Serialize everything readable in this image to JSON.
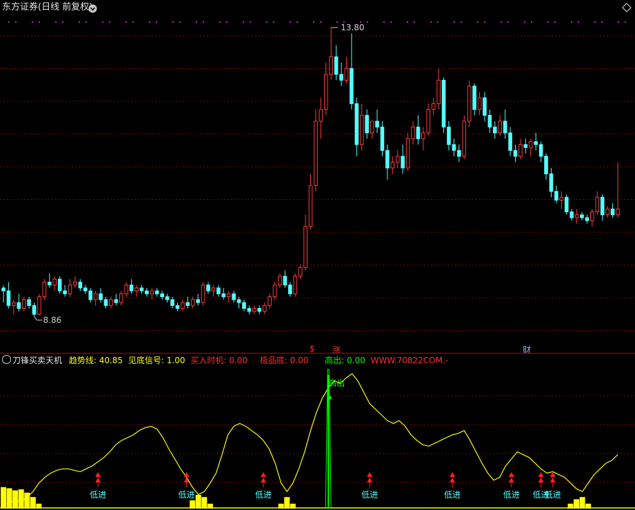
{
  "window": {
    "title": "东方证券(日线 前复权)",
    "collapse_icon": "circle-chevron-down-icon",
    "corner_icon": "diamond-icon"
  },
  "main_chart": {
    "high_label": "13.80",
    "low_label": "8.86",
    "event_tags": [
      {
        "text": "$",
        "color": "#ff3030"
      },
      {
        "text": "涨",
        "color": "#ff3030"
      },
      {
        "text": "财",
        "color": "#8fb0ff"
      }
    ]
  },
  "indicator": {
    "name": "刀锋买卖天机",
    "values": [
      {
        "label": "趋势线:",
        "value": "40.85",
        "color": "#ffff00"
      },
      {
        "label": "见底信号:",
        "value": "1.00",
        "color": "#ffff00"
      },
      {
        "label": "买入时机:",
        "value": "0.00",
        "color": "#ff3030"
      },
      {
        "label": "极品底:",
        "value": "0.00",
        "color": "#ff3030"
      },
      {
        "label": "高出:",
        "value": "0.00",
        "color": "#00ff00"
      }
    ],
    "website": "WWW.70822COM.-",
    "sell_label": "高出",
    "buy_label": "低进"
  },
  "colors": {
    "up": "#ff3c3c",
    "down": "#54ffff",
    "grid": "#8b0000",
    "trend": "#ffff00",
    "signal": "#00ff00"
  },
  "chart_data": [
    {
      "type": "candlestick",
      "title": "东方证券(日线 前复权)",
      "ylim": [
        8.5,
        14.0
      ],
      "annotations": {
        "max": 13.8,
        "min": 8.86
      },
      "candles": [
        [
          9.35,
          9.4,
          9.1,
          9.3
        ],
        [
          9.3,
          9.45,
          9.0,
          9.05
        ],
        [
          9.05,
          9.15,
          8.9,
          9.1
        ],
        [
          9.1,
          9.25,
          8.95,
          9.0
        ],
        [
          9.0,
          9.2,
          8.95,
          9.15
        ],
        [
          9.15,
          9.2,
          9.0,
          9.05
        ],
        [
          9.05,
          9.1,
          8.86,
          8.9
        ],
        [
          8.9,
          9.25,
          8.88,
          9.2
        ],
        [
          9.2,
          9.5,
          9.15,
          9.45
        ],
        [
          9.45,
          9.6,
          9.35,
          9.4
        ],
        [
          9.4,
          9.55,
          9.3,
          9.5
        ],
        [
          9.5,
          9.55,
          9.25,
          9.3
        ],
        [
          9.3,
          9.4,
          9.2,
          9.25
        ],
        [
          9.25,
          9.5,
          9.2,
          9.4
        ],
        [
          9.4,
          9.55,
          9.35,
          9.45
        ],
        [
          9.45,
          9.5,
          9.3,
          9.35
        ],
        [
          9.35,
          9.4,
          9.25,
          9.3
        ],
        [
          9.3,
          9.35,
          9.1,
          9.15
        ],
        [
          9.15,
          9.3,
          9.05,
          9.25
        ],
        [
          9.25,
          9.35,
          9.1,
          9.15
        ],
        [
          9.15,
          9.2,
          9.0,
          9.05
        ],
        [
          9.05,
          9.2,
          9.0,
          9.15
        ],
        [
          9.15,
          9.25,
          9.05,
          9.1
        ],
        [
          9.1,
          9.3,
          9.05,
          9.25
        ],
        [
          9.25,
          9.45,
          9.2,
          9.4
        ],
        [
          9.4,
          9.5,
          9.25,
          9.3
        ],
        [
          9.3,
          9.4,
          9.2,
          9.35
        ],
        [
          9.35,
          9.4,
          9.25,
          9.3
        ],
        [
          9.3,
          9.35,
          9.2,
          9.25
        ],
        [
          9.25,
          9.35,
          9.15,
          9.3
        ],
        [
          9.3,
          9.35,
          9.2,
          9.25
        ],
        [
          9.25,
          9.3,
          9.15,
          9.2
        ],
        [
          9.2,
          9.25,
          9.1,
          9.15
        ],
        [
          9.15,
          9.2,
          9.0,
          9.05
        ],
        [
          9.05,
          9.1,
          8.95,
          9.0
        ],
        [
          9.0,
          9.15,
          8.95,
          9.1
        ],
        [
          9.1,
          9.2,
          9.0,
          9.05
        ],
        [
          9.05,
          9.2,
          9.0,
          9.15
        ],
        [
          9.15,
          9.25,
          9.05,
          9.1
        ],
        [
          9.1,
          9.45,
          9.05,
          9.4
        ],
        [
          9.4,
          9.45,
          9.25,
          9.3
        ],
        [
          9.3,
          9.4,
          9.2,
          9.35
        ],
        [
          9.35,
          9.4,
          9.2,
          9.25
        ],
        [
          9.25,
          9.35,
          9.15,
          9.2
        ],
        [
          9.2,
          9.3,
          9.1,
          9.25
        ],
        [
          9.25,
          9.3,
          9.1,
          9.15
        ],
        [
          9.15,
          9.2,
          9.0,
          9.1
        ],
        [
          9.1,
          9.15,
          8.95,
          9.0
        ],
        [
          9.0,
          9.05,
          8.9,
          8.95
        ],
        [
          8.95,
          9.05,
          8.9,
          9.0
        ],
        [
          9.0,
          9.05,
          8.9,
          8.95
        ],
        [
          8.95,
          9.1,
          8.9,
          9.05
        ],
        [
          9.05,
          9.25,
          9.0,
          9.2
        ],
        [
          9.2,
          9.45,
          9.15,
          9.4
        ],
        [
          9.4,
          9.6,
          9.35,
          9.55
        ],
        [
          9.55,
          9.65,
          9.35,
          9.4
        ],
        [
          9.4,
          9.45,
          9.2,
          9.25
        ],
        [
          9.25,
          9.6,
          9.2,
          9.55
        ],
        [
          9.55,
          9.75,
          9.5,
          9.7
        ],
        [
          9.7,
          10.6,
          9.65,
          10.4
        ],
        [
          10.4,
          11.3,
          10.35,
          11.1
        ],
        [
          11.1,
          12.4,
          11.0,
          12.2
        ],
        [
          12.2,
          12.6,
          11.9,
          12.4
        ],
        [
          12.4,
          13.2,
          12.3,
          13.0
        ],
        [
          13.0,
          13.8,
          12.9,
          13.3
        ],
        [
          13.3,
          13.5,
          12.9,
          13.0
        ],
        [
          13.0,
          13.2,
          12.8,
          12.9
        ],
        [
          12.9,
          13.3,
          12.85,
          13.1
        ],
        [
          13.1,
          13.7,
          12.4,
          12.5
        ],
        [
          12.5,
          12.6,
          11.6,
          11.8
        ],
        [
          11.8,
          12.5,
          11.7,
          12.3
        ],
        [
          12.3,
          12.4,
          11.9,
          12.0
        ],
        [
          12.0,
          12.1,
          11.9,
          12.2
        ],
        [
          12.2,
          12.4,
          12.0,
          12.1
        ],
        [
          12.1,
          12.2,
          11.6,
          11.7
        ],
        [
          11.7,
          11.8,
          11.2,
          11.4
        ],
        [
          11.4,
          11.6,
          11.3,
          11.5
        ],
        [
          11.5,
          11.7,
          11.4,
          11.6
        ],
        [
          11.6,
          11.8,
          11.3,
          11.4
        ],
        [
          11.4,
          12.0,
          11.35,
          11.9
        ],
        [
          11.9,
          12.2,
          11.8,
          12.1
        ],
        [
          12.1,
          12.3,
          11.8,
          11.9
        ],
        [
          11.9,
          12.1,
          11.7,
          12.0
        ],
        [
          12.0,
          12.5,
          11.95,
          12.4
        ],
        [
          12.4,
          12.6,
          12.3,
          12.5
        ],
        [
          12.5,
          13.1,
          12.4,
          12.9
        ],
        [
          12.9,
          12.95,
          12.0,
          12.1
        ],
        [
          12.1,
          12.2,
          11.7,
          11.8
        ],
        [
          11.8,
          11.9,
          11.6,
          11.7
        ],
        [
          11.7,
          11.8,
          11.5,
          11.6
        ],
        [
          11.6,
          12.3,
          11.55,
          12.2
        ],
        [
          12.2,
          12.9,
          12.1,
          12.8
        ],
        [
          12.8,
          12.85,
          12.3,
          12.4
        ],
        [
          12.4,
          12.7,
          12.3,
          12.6
        ],
        [
          12.6,
          12.7,
          12.2,
          12.3
        ],
        [
          12.3,
          12.4,
          12.0,
          12.1
        ],
        [
          12.1,
          12.2,
          11.9,
          12.0
        ],
        [
          12.0,
          12.3,
          11.95,
          12.2
        ],
        [
          12.2,
          12.4,
          11.9,
          12.0
        ],
        [
          12.0,
          12.1,
          11.6,
          11.7
        ],
        [
          11.7,
          11.8,
          11.5,
          11.6
        ],
        [
          11.6,
          11.9,
          11.55,
          11.8
        ],
        [
          11.8,
          11.9,
          11.65,
          11.75
        ],
        [
          11.75,
          11.9,
          11.6,
          11.85
        ],
        [
          11.85,
          12.0,
          11.7,
          11.8
        ],
        [
          11.8,
          11.85,
          11.5,
          11.6
        ],
        [
          11.6,
          11.65,
          11.2,
          11.3
        ],
        [
          11.3,
          11.4,
          10.9,
          11.0
        ],
        [
          11.0,
          11.1,
          10.8,
          10.85
        ],
        [
          10.85,
          11.0,
          10.7,
          10.9
        ],
        [
          10.9,
          10.95,
          10.6,
          10.65
        ],
        [
          10.65,
          10.7,
          10.5,
          10.55
        ],
        [
          10.55,
          10.7,
          10.45,
          10.6
        ],
        [
          10.6,
          10.65,
          10.5,
          10.55
        ],
        [
          10.55,
          10.6,
          10.45,
          10.5
        ],
        [
          10.5,
          10.7,
          10.4,
          10.65
        ],
        [
          10.65,
          11.0,
          10.6,
          10.9
        ],
        [
          10.9,
          10.95,
          10.5,
          10.6
        ],
        [
          10.6,
          10.75,
          10.55,
          10.7
        ],
        [
          10.7,
          10.8,
          10.55,
          10.6
        ],
        [
          10.6,
          11.5,
          10.55,
          10.7
        ]
      ]
    },
    {
      "type": "line",
      "title": "刀锋买卖天机",
      "ylim": [
        0,
        100
      ],
      "series": [
        {
          "name": "趋势线",
          "values": [
            3,
            4,
            6,
            5,
            8,
            12,
            18,
            22,
            25,
            27,
            28,
            28,
            27,
            26,
            28,
            30,
            33,
            36,
            40,
            45,
            48,
            50,
            52,
            55,
            57,
            58,
            56,
            50,
            42,
            35,
            28,
            22,
            15,
            10,
            12,
            18,
            25,
            38,
            52,
            58,
            60,
            58,
            55,
            52,
            48,
            42,
            32,
            18,
            12,
            18,
            28,
            40,
            55,
            68,
            78,
            85,
            90,
            88,
            92,
            95,
            90,
            82,
            74,
            70,
            66,
            62,
            60,
            62,
            58,
            52,
            48,
            45,
            44,
            46,
            48,
            50,
            52,
            53,
            55,
            48,
            40,
            32,
            25,
            20,
            22,
            30,
            35,
            40,
            38,
            36,
            32,
            28,
            25,
            26,
            24,
            22,
            18,
            14,
            12,
            18,
            24,
            28,
            32,
            34,
            38
          ]
        }
      ],
      "markers": {
        "buy_signal_at": [
          16,
          31,
          44,
          62,
          76,
          86,
          91,
          93
        ],
        "sell_signal_at": [
          55
        ]
      }
    }
  ]
}
